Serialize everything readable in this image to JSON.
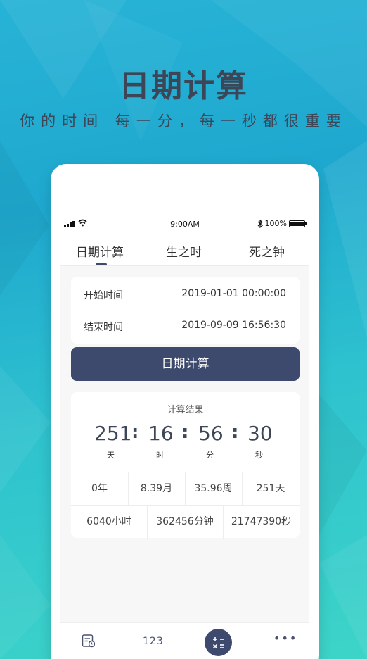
{
  "hero": {
    "title": "日期计算",
    "subtitle": "你的时间 每一分，每一秒都很重要"
  },
  "status_bar": {
    "time": "9:00AM",
    "battery": "100%",
    "battery_level": 1.0,
    "icons": [
      "signal-icon",
      "wifi-icon",
      "bluetooth-icon",
      "battery-icon"
    ]
  },
  "tabs": [
    {
      "label": "日期计算",
      "active": true
    },
    {
      "label": "生之时",
      "active": false
    },
    {
      "label": "死之钟",
      "active": false
    }
  ],
  "form": {
    "start_label": "开始时间",
    "start_value": "2019-01-01 00:00:00",
    "end_label": "结束时间",
    "end_value": "2019-09-09 16:56:30"
  },
  "calc_button": "日期计算",
  "result": {
    "title": "计算结果",
    "countdown": [
      {
        "value": "251",
        "unit": "天"
      },
      {
        "value": "16",
        "unit": "时"
      },
      {
        "value": "56",
        "unit": "分"
      },
      {
        "value": "30",
        "unit": "秒"
      }
    ],
    "separator": ":",
    "row1": [
      "0年",
      "8.39月",
      "35.96周",
      "251天"
    ],
    "row2": [
      "6040小时",
      "362456分钟",
      "21747390秒"
    ]
  },
  "bottom_nav": {
    "number_label": "123",
    "icons": [
      "calendar-clock-icon",
      "calculator-icon",
      "more-icon"
    ]
  },
  "colors": {
    "accent": "#3e4a6d",
    "background_top": "#27b3d6",
    "background_bottom": "#3dd4c8"
  }
}
